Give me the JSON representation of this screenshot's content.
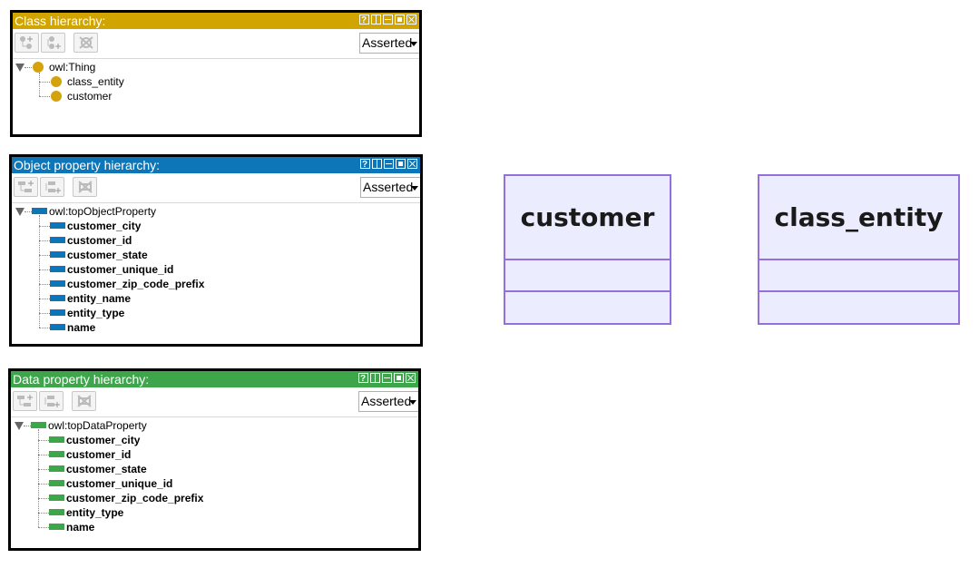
{
  "class_panel": {
    "title": "Class hierarchy:",
    "title_color": "#d1a400",
    "select": "Asserted",
    "root": "owl:Thing",
    "items": [
      "class_entity",
      "customer"
    ]
  },
  "object_panel": {
    "title": "Object property hierarchy:",
    "title_color": "#0d76b8",
    "select": "Asserted",
    "root": "owl:topObjectProperty",
    "items": [
      "customer_city",
      "customer_id",
      "customer_state",
      "customer_unique_id",
      "customer_zip_code_prefix",
      "entity_name",
      "entity_type",
      "name"
    ]
  },
  "data_panel": {
    "title": "Data property hierarchy:",
    "title_color": "#3da54a",
    "select": "Asserted",
    "root": "owl:topDataProperty",
    "items": [
      "customer_city",
      "customer_id",
      "customer_state",
      "customer_unique_id",
      "customer_zip_code_prefix",
      "entity_type",
      "name"
    ]
  },
  "diagram": {
    "classes": [
      "customer",
      "class_entity"
    ],
    "fill": "#ececff",
    "stroke": "#9370db"
  },
  "icons": {
    "window_buttons": [
      "help-icon",
      "split-icon",
      "minimize-icon",
      "maximize-icon",
      "close-icon"
    ],
    "class_toolbar": [
      "add-subclass-icon",
      "add-sibling-class-icon",
      "delete-class-icon"
    ],
    "property_toolbar": [
      "add-subproperty-icon",
      "add-sibling-property-icon",
      "delete-property-icon"
    ]
  }
}
